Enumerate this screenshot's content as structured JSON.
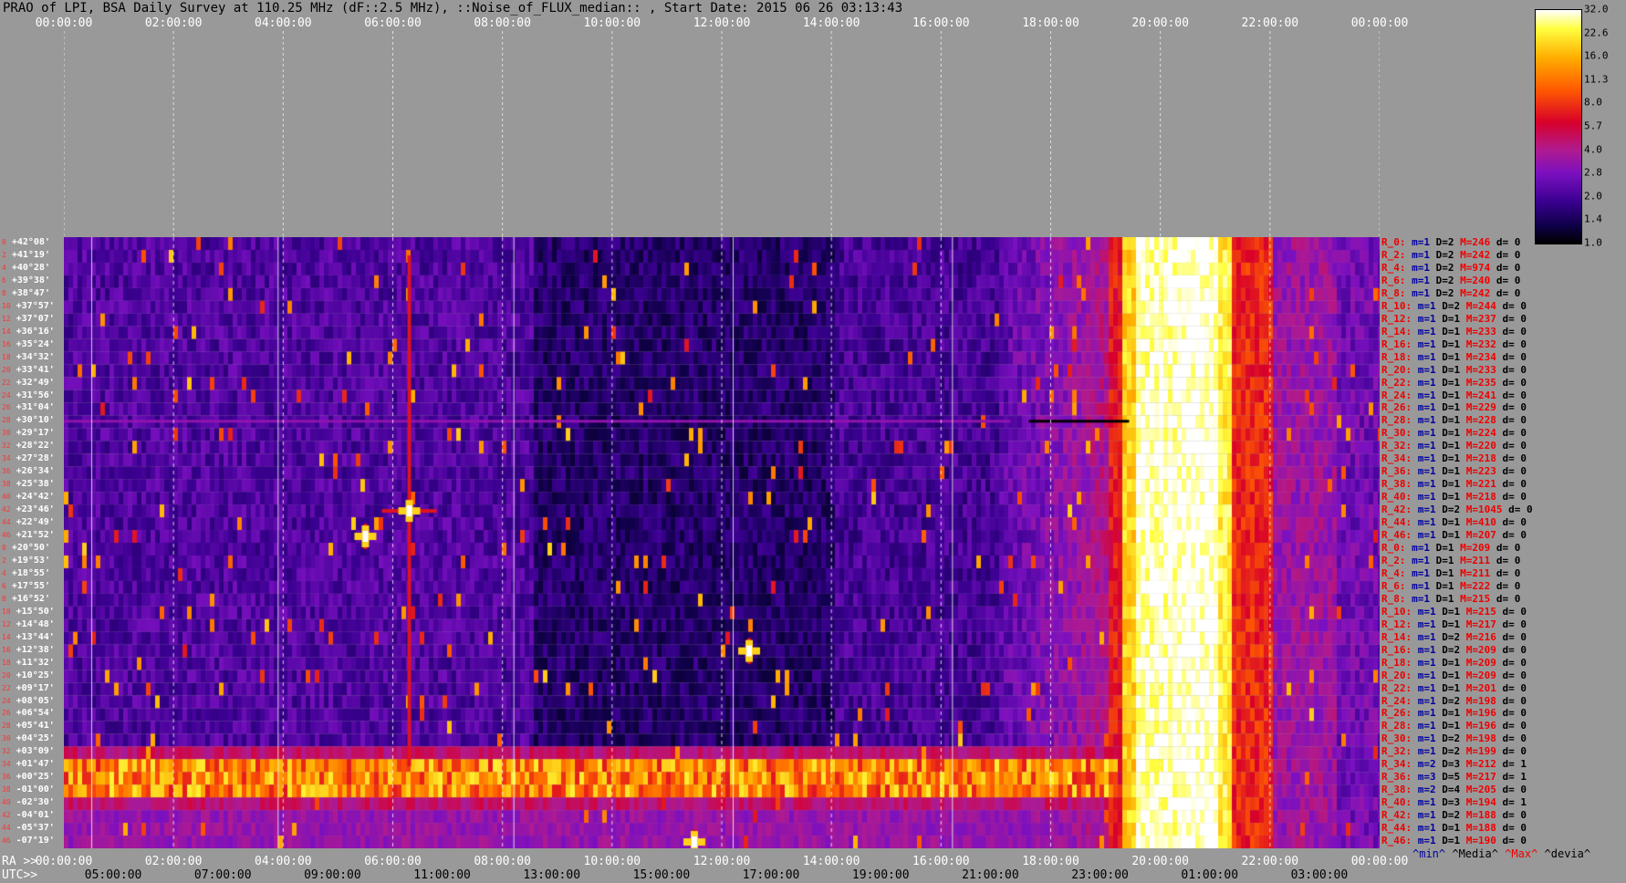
{
  "title": "PRAO of LPI, BSA Daily Survey at 110.25 MHz (dF::2.5 MHz), ::Noise_of_FLUX_median:: , Start Date: 2015 06 26 03:13:43",
  "top_axis_ticks": [
    "00:00:00",
    "02:00:00",
    "04:00:00",
    "06:00:00",
    "08:00:00",
    "10:00:00",
    "12:00:00",
    "14:00:00",
    "16:00:00",
    "18:00:00",
    "20:00:00",
    "22:00:00",
    "00:00:00"
  ],
  "ra_axis": {
    "prefix": "RA >>",
    "ticks": [
      "00:00:00",
      "02:00:00",
      "04:00:00",
      "06:00:00",
      "08:00:00",
      "10:00:00",
      "12:00:00",
      "14:00:00",
      "16:00:00",
      "18:00:00",
      "20:00:00",
      "22:00:00",
      "00:00:00"
    ]
  },
  "utc_axis": {
    "prefix": "UTC>>",
    "ticks": [
      "05:00:00",
      "07:00:00",
      "09:00:00",
      "11:00:00",
      "13:00:00",
      "15:00:00",
      "17:00:00",
      "19:00:00",
      "21:00:00",
      "23:00:00",
      "01:00:00",
      "03:00:00"
    ]
  },
  "colors": {
    "background": "#999999",
    "label_red": "#ff3333",
    "min": "#0000a0",
    "max": "#e00000"
  },
  "colorbar": {
    "labels": [
      "32.0",
      "22.6",
      "16.0",
      "11.3",
      "8.0",
      "5.7",
      "4.0",
      "2.8",
      "2.0",
      "1.4",
      "1.0"
    ],
    "scale": "log"
  },
  "declinations": [
    {
      "n": "0",
      "v": "+42°08'"
    },
    {
      "n": "2",
      "v": "+41°19'"
    },
    {
      "n": "4",
      "v": "+40°28'"
    },
    {
      "n": "6",
      "v": "+39°38'"
    },
    {
      "n": "8",
      "v": "+38°47'"
    },
    {
      "n": "10",
      "v": "+37°57'"
    },
    {
      "n": "12",
      "v": "+37°07'"
    },
    {
      "n": "14",
      "v": "+36°16'"
    },
    {
      "n": "16",
      "v": "+35°24'"
    },
    {
      "n": "18",
      "v": "+34°32'"
    },
    {
      "n": "20",
      "v": "+33°41'"
    },
    {
      "n": "22",
      "v": "+32°49'"
    },
    {
      "n": "24",
      "v": "+31°56'"
    },
    {
      "n": "26",
      "v": "+31°04'"
    },
    {
      "n": "28",
      "v": "+30°10'"
    },
    {
      "n": "30",
      "v": "+29°17'"
    },
    {
      "n": "32",
      "v": "+28°22'"
    },
    {
      "n": "34",
      "v": "+27°28'"
    },
    {
      "n": "36",
      "v": "+26°34'"
    },
    {
      "n": "38",
      "v": "+25°38'"
    },
    {
      "n": "40",
      "v": "+24°42'"
    },
    {
      "n": "42",
      "v": "+23°46'"
    },
    {
      "n": "44",
      "v": "+22°49'"
    },
    {
      "n": "46",
      "v": "+21°52'"
    },
    {
      "n": "0",
      "v": "+20°50'"
    },
    {
      "n": "2",
      "v": "+19°53'"
    },
    {
      "n": "4",
      "v": "+18°55'"
    },
    {
      "n": "6",
      "v": "+17°55'"
    },
    {
      "n": "8",
      "v": "+16°52'"
    },
    {
      "n": "10",
      "v": "+15°50'"
    },
    {
      "n": "12",
      "v": "+14°48'"
    },
    {
      "n": "14",
      "v": "+13°44'"
    },
    {
      "n": "16",
      "v": "+12°38'"
    },
    {
      "n": "18",
      "v": "+11°32'"
    },
    {
      "n": "20",
      "v": "+10°25'"
    },
    {
      "n": "22",
      "v": "+09°17'"
    },
    {
      "n": "24",
      "v": "+08°05'"
    },
    {
      "n": "26",
      "v": "+06°54'"
    },
    {
      "n": "28",
      "v": "+05°41'"
    },
    {
      "n": "30",
      "v": "+04°25'"
    },
    {
      "n": "32",
      "v": "+03°09'"
    },
    {
      "n": "34",
      "v": "+01°47'"
    },
    {
      "n": "36",
      "v": "+00°25'"
    },
    {
      "n": "38",
      "v": "-01°00'"
    },
    {
      "n": "40",
      "v": "-02°30'"
    },
    {
      "n": "42",
      "v": "-04°01'"
    },
    {
      "n": "44",
      "v": "-05°37'"
    },
    {
      "n": "46",
      "v": "-07°19'"
    }
  ],
  "stats_rows": [
    {
      "r": "R_0:",
      "m": "m=1",
      "D": "D=2",
      "M": "M=246",
      "d": "d= 0"
    },
    {
      "r": "R_2:",
      "m": "m=1",
      "D": "D=2",
      "M": "M=242",
      "d": "d= 0"
    },
    {
      "r": "R_4:",
      "m": "m=1",
      "D": "D=2",
      "M": "M=974",
      "d": "d= 0"
    },
    {
      "r": "R_6:",
      "m": "m=1",
      "D": "D=2",
      "M": "M=240",
      "d": "d= 0"
    },
    {
      "r": "R_8:",
      "m": "m=1",
      "D": "D=2",
      "M": "M=242",
      "d": "d= 0"
    },
    {
      "r": "R_10:",
      "m": "m=1",
      "D": "D=2",
      "M": "M=244",
      "d": "d= 0"
    },
    {
      "r": "R_12:",
      "m": "m=1",
      "D": "D=1",
      "M": "M=237",
      "d": "d= 0"
    },
    {
      "r": "R_14:",
      "m": "m=1",
      "D": "D=1",
      "M": "M=233",
      "d": "d= 0"
    },
    {
      "r": "R_16:",
      "m": "m=1",
      "D": "D=1",
      "M": "M=232",
      "d": "d= 0"
    },
    {
      "r": "R_18:",
      "m": "m=1",
      "D": "D=1",
      "M": "M=234",
      "d": "d= 0"
    },
    {
      "r": "R_20:",
      "m": "m=1",
      "D": "D=1",
      "M": "M=233",
      "d": "d= 0"
    },
    {
      "r": "R_22:",
      "m": "m=1",
      "D": "D=1",
      "M": "M=235",
      "d": "d= 0"
    },
    {
      "r": "R_24:",
      "m": "m=1",
      "D": "D=1",
      "M": "M=241",
      "d": "d= 0"
    },
    {
      "r": "R_26:",
      "m": "m=1",
      "D": "D=1",
      "M": "M=229",
      "d": "d= 0"
    },
    {
      "r": "R_28:",
      "m": "m=1",
      "D": "D=1",
      "M": "M=228",
      "d": "d= 0"
    },
    {
      "r": "R_30:",
      "m": "m=1",
      "D": "D=1",
      "M": "M=224",
      "d": "d= 0"
    },
    {
      "r": "R_32:",
      "m": "m=1",
      "D": "D=1",
      "M": "M=220",
      "d": "d= 0"
    },
    {
      "r": "R_34:",
      "m": "m=1",
      "D": "D=1",
      "M": "M=218",
      "d": "d= 0"
    },
    {
      "r": "R_36:",
      "m": "m=1",
      "D": "D=1",
      "M": "M=223",
      "d": "d= 0"
    },
    {
      "r": "R_38:",
      "m": "m=1",
      "D": "D=1",
      "M": "M=221",
      "d": "d= 0"
    },
    {
      "r": "R_40:",
      "m": "m=1",
      "D": "D=1",
      "M": "M=218",
      "d": "d= 0"
    },
    {
      "r": "R_42:",
      "m": "m=1",
      "D": "D=2",
      "M": "M=1045",
      "d": "d= 0"
    },
    {
      "r": "R_44:",
      "m": "m=1",
      "D": "D=1",
      "M": "M=410",
      "d": "d= 0"
    },
    {
      "r": "R_46:",
      "m": "m=1",
      "D": "D=1",
      "M": "M=207",
      "d": "d= 0"
    },
    {
      "r": "R_0:",
      "m": "m=1",
      "D": "D=1",
      "M": "M=209",
      "d": "d= 0"
    },
    {
      "r": "R_2:",
      "m": "m=1",
      "D": "D=1",
      "M": "M=211",
      "d": "d= 0"
    },
    {
      "r": "R_4:",
      "m": "m=1",
      "D": "D=1",
      "M": "M=211",
      "d": "d= 0"
    },
    {
      "r": "R_6:",
      "m": "m=1",
      "D": "D=1",
      "M": "M=222",
      "d": "d= 0"
    },
    {
      "r": "R_8:",
      "m": "m=1",
      "D": "D=1",
      "M": "M=215",
      "d": "d= 0"
    },
    {
      "r": "R_10:",
      "m": "m=1",
      "D": "D=1",
      "M": "M=215",
      "d": "d= 0"
    },
    {
      "r": "R_12:",
      "m": "m=1",
      "D": "D=1",
      "M": "M=217",
      "d": "d= 0"
    },
    {
      "r": "R_14:",
      "m": "m=1",
      "D": "D=2",
      "M": "M=216",
      "d": "d= 0"
    },
    {
      "r": "R_16:",
      "m": "m=1",
      "D": "D=2",
      "M": "M=209",
      "d": "d= 0"
    },
    {
      "r": "R_18:",
      "m": "m=1",
      "D": "D=1",
      "M": "M=209",
      "d": "d= 0"
    },
    {
      "r": "R_20:",
      "m": "m=1",
      "D": "D=1",
      "M": "M=209",
      "d": "d= 0"
    },
    {
      "r": "R_22:",
      "m": "m=1",
      "D": "D=1",
      "M": "M=201",
      "d": "d= 0"
    },
    {
      "r": "R_24:",
      "m": "m=1",
      "D": "D=2",
      "M": "M=198",
      "d": "d= 0"
    },
    {
      "r": "R_26:",
      "m": "m=1",
      "D": "D=1",
      "M": "M=196",
      "d": "d= 0"
    },
    {
      "r": "R_28:",
      "m": "m=1",
      "D": "D=1",
      "M": "M=196",
      "d": "d= 0"
    },
    {
      "r": "R_30:",
      "m": "m=1",
      "D": "D=2",
      "M": "M=198",
      "d": "d= 0"
    },
    {
      "r": "R_32:",
      "m": "m=1",
      "D": "D=2",
      "M": "M=199",
      "d": "d= 0"
    },
    {
      "r": "R_34:",
      "m": "m=2",
      "D": "D=3",
      "M": "M=212",
      "d": "d= 1"
    },
    {
      "r": "R_36:",
      "m": "m=3",
      "D": "D=5",
      "M": "M=217",
      "d": "d= 1"
    },
    {
      "r": "R_38:",
      "m": "m=2",
      "D": "D=4",
      "M": "M=205",
      "d": "d= 0"
    },
    {
      "r": "R_40:",
      "m": "m=1",
      "D": "D=3",
      "M": "M=194",
      "d": "d= 1"
    },
    {
      "r": "R_42:",
      "m": "m=1",
      "D": "D=2",
      "M": "M=188",
      "d": "d= 0"
    },
    {
      "r": "R_44:",
      "m": "m=1",
      "D": "D=1",
      "M": "M=188",
      "d": "d= 0"
    },
    {
      "r": "R_46:",
      "m": "m=1",
      "D": "D=1",
      "M": "M=190",
      "d": "d= 0"
    }
  ],
  "stats_footer": {
    "min": "^min^",
    "median": "^Media^",
    "max": "^Max^",
    "devia": "^devia^"
  },
  "chart_data": {
    "type": "heatmap",
    "title": "PRAO of LPI, BSA Daily Survey at 110.25 MHz (dF::2.5 MHz), ::Noise_of_FLUX_median:: , Start Date: 2015 06 26 03:13:43",
    "x_axis": "RA (hours)",
    "xlim": [
      0,
      24
    ],
    "y_axis": "Declination beam rows",
    "rows": 48,
    "color_scale": "log",
    "zlim": [
      1.0,
      32.0
    ],
    "features": [
      {
        "kind": "vertical_band",
        "ra_start": 19.2,
        "ra_end": 21.4,
        "level": "max"
      },
      {
        "kind": "vertical_band",
        "ra_start": 21.4,
        "ra_end": 22.2,
        "level": "high"
      },
      {
        "kind": "horizontal_band",
        "rows": [
          41,
          43
        ],
        "level": "high"
      },
      {
        "kind": "horizontal_line",
        "row": 14,
        "ra_start": 0.0,
        "ra_end": 19.6,
        "level": "medium"
      },
      {
        "kind": "point_source",
        "ra": 6.3,
        "row": 21,
        "level": "max"
      },
      {
        "kind": "point_source",
        "ra": 5.5,
        "row": 23,
        "level": "max"
      },
      {
        "kind": "point_source",
        "ra": 12.5,
        "row": 32,
        "level": "max"
      },
      {
        "kind": "point_source",
        "ra": 11.5,
        "row": 47,
        "level": "max"
      }
    ]
  }
}
